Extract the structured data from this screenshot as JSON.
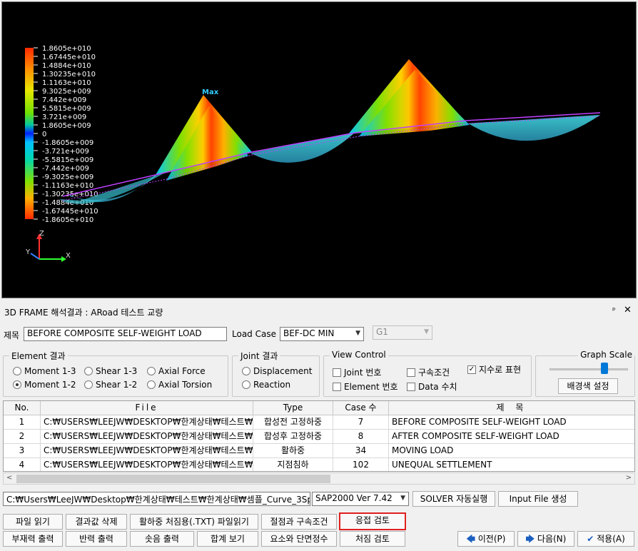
{
  "viewport": {
    "legend": [
      "1.8605e+010",
      "1.67445e+010",
      "1.4884e+010",
      "1.30235e+010",
      "1.1163e+010",
      "9.3025e+009",
      "7.442e+009",
      "5.5815e+009",
      "3.721e+009",
      "1.8605e+009",
      "0",
      "-1.8605e+009",
      "-3.721e+009",
      "-5.5815e+009",
      "-7.442e+009",
      "-9.3025e+009",
      "-1.1163e+010",
      "-1.30235e+010",
      "-1.4884e+010",
      "-1.67445e+010",
      "-1.8605e+010"
    ],
    "max_label": "Max",
    "axis": {
      "z": "Z",
      "x": "X",
      "y": "Y"
    }
  },
  "panel": {
    "title": "3D FRAME 해석결과 : ARoad 테스트 교량",
    "pin": "ᵖ",
    "close": "✕"
  },
  "form": {
    "title_label": "제목",
    "title_value": "BEFORE COMPOSITE SELF-WEIGHT LOAD",
    "load_case_label": "Load Case",
    "load_case_value": "BEF-DC MIN",
    "girder_value": "G1"
  },
  "element_group": {
    "title": "Element 결과",
    "options": [
      "Moment 1-3",
      "Shear 1-3",
      "Axial Force",
      "Moment 1-2",
      "Shear 1-2",
      "Axial Torsion"
    ],
    "selected": "Moment 1-2"
  },
  "joint_group": {
    "title": "Joint 결과",
    "options": [
      "Displacement",
      "Reaction"
    ]
  },
  "view_control": {
    "title": "View Control",
    "checks": [
      {
        "label": "Joint 번호",
        "checked": false
      },
      {
        "label": "구속조건",
        "checked": false
      },
      {
        "label": "지수로 표현",
        "checked": true
      },
      {
        "label": "Element 번호",
        "checked": false
      },
      {
        "label": "Data 수치",
        "checked": false
      }
    ]
  },
  "graph_scale": {
    "title": "Graph Scale",
    "bg_button": "배경색 설정",
    "level": 0.7
  },
  "table": {
    "headers": [
      "No.",
      "File",
      "Type",
      "Case 수",
      "제 목"
    ],
    "rows": [
      [
        "1",
        "C:₩USERS₩LEEJW₩DESKTOP₩한계상태₩테스트₩한계",
        "합성전 고정하중",
        "7",
        "BEFORE COMPOSITE SELF-WEIGHT LOAD"
      ],
      [
        "2",
        "C:₩USERS₩LEEJW₩DESKTOP₩한계상태₩테스트₩한계",
        "합성후 고정하중",
        "8",
        "AFTER COMPOSITE SELF-WEIGHT LOAD"
      ],
      [
        "3",
        "C:₩USERS₩LEEJW₩DESKTOP₩한계상태₩테스트₩한계",
        "활하중",
        "34",
        "MOVING LOAD"
      ],
      [
        "4",
        "C:₩USERS₩LEEJW₩DESKTOP₩한계상태₩테스트₩한계",
        "지점침하",
        "102",
        "UNEQUAL SETTLEMENT"
      ]
    ]
  },
  "bottom": {
    "path_value": "C:₩Users₩LeeJW₩Desktop₩한계상태₩테스트₩한계상태₩셈플_Curve_3Sp",
    "solver_version": "SAP2000 Ver 7.42",
    "solver_button": "SOLVER 자동실행",
    "input_button": "Input File 생성",
    "buttons_row1": [
      "파일 읽기",
      "결과값 삭제",
      "활하중 처짐용(.TXT) 파일읽기",
      "절점과 구속조건",
      "응접 검토"
    ],
    "buttons_row2": [
      "부재력 출력",
      "반력 출력",
      "솟음 출력",
      "합계 보기",
      "요소와 단면정수",
      "처짐 검토"
    ],
    "prev": "이전(P)",
    "next": "다음(N)",
    "apply": "적용(A)"
  }
}
